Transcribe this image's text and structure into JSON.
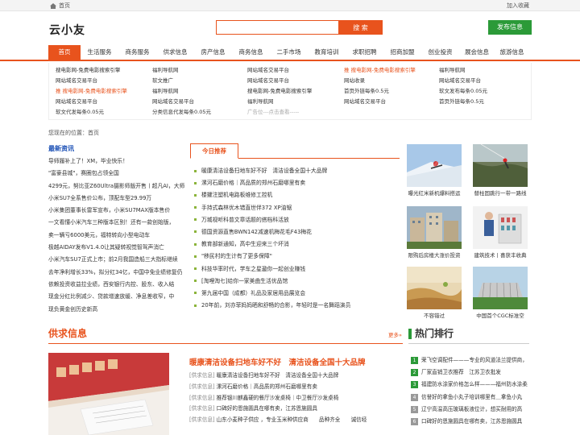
{
  "topbar": {
    "home": "首页",
    "favorite": "加入收藏"
  },
  "logo": "云小友",
  "search": {
    "placeholder": "",
    "button": "搜 索"
  },
  "publish": "发布信息",
  "nav": [
    "首页",
    "生活服务",
    "商务服务",
    "供求信息",
    "房产信息",
    "商务信息",
    "二手市场",
    "教育培训",
    "求职招聘",
    "招商加盟",
    "创业投资",
    "展会信息",
    "旅游信息"
  ],
  "links": {
    "col1": [
      "搜电影网-免费电影搜索引擎",
      "网站域名交易平台",
      "推 搜电影网-免费电影搜索引擎",
      "网站域名交易平台",
      "软文代发每条0.05元"
    ],
    "col2": [
      "福利导航网",
      "软文推广",
      "福利导航网",
      "网站域名交易平台",
      "分类信息代发每条0.05元"
    ],
    "col3": [
      "网站域名交易平台",
      "网站域名交易平台",
      "搜电影网-免费电影搜索引擎",
      "福利导航网",
      "广告位---点击查看-----"
    ],
    "col4": [
      "推 搜电影网-免费电影搜索引擎",
      "网站收录",
      "首页外链每条0.5元",
      "网站域名交易平台"
    ],
    "col5": [
      "福利导航网",
      "网站域名交易平台",
      "软文发布每条0.05元",
      "首页外链每条0.5元"
    ]
  },
  "breadcrumb": "您现在的位置：首页",
  "latest": {
    "title": "最新资讯",
    "items": [
      "导师履补上了！XM，毕业快乐！",
      "\"富豪县城\"，赛圈包占领全国",
      "4299元，努比亚Z60Ultra摄影师版开售丨超凡AI，大师",
      "小米SU7全系售价公布，顶配车型29.99万",
      "小米集团董事长雷军宣布，小米SU7MAX版本售价",
      "一文看懂小米汽车三种版本区别！还有一款创始版，",
      "卖一辆亏6000美元，福特转向小型电动车",
      "极越AIDAY发布V1.4.0让其疑转视觉智驾声消亡",
      "小米汽车SU7正式上市；前2月我国造船三大指标继续",
      "去年净利增长33%，拟分红34亿，中国中免业绩修复仍",
      "依赖投资收益拉业绩，西安银行内控、股东、收入结",
      "现金分红比例减少、贷款增速放缓、净息差收窄，中",
      "现负黄金创历史新高"
    ]
  },
  "recommend": {
    "tab": "今日推荐",
    "items": [
      "暖康清洁设备扫地车好不好　清洁设备全国十大品牌",
      "漯河石磨价格｜高品质的郑州石磨哪里有卖",
      "楼攉注塑机电路板维修工控机",
      "手持式森林优木错直世伴372 XP油锯",
      "万城视听科普文章话题的搭档科活放",
      "德国资源直售BWN142减速机梅花毛F43梅花",
      "教育部新通知，高中生迎来三个坏消",
      "\"移民村的生计有了更多保障\"",
      "科技华率时代，学车之星遨你一起创业赚钱",
      "[淘哩淘七]给你一家美曲生活优品馆",
      "第九届中国（成都）礼品及家居用品展览会",
      "20年前，刘亦菲妈妈晒和舒畅的合影，年轻时是一名舞蹈演员"
    ]
  },
  "pictures": [
    {
      "caption": "曝光红米新机爆料搭运",
      "icon": "skiing-photo"
    },
    {
      "caption": "替柱固跳行一带一路线",
      "icon": "bungee-photo"
    },
    {
      "caption": "限购后房楼大涨价投资",
      "icon": "housing-photo"
    },
    {
      "caption": "建筑技术丨喜获丰收典",
      "icon": "vending-photo"
    },
    {
      "caption": "不容错过",
      "icon": "desert-photo"
    },
    {
      "caption": "中国首个CGC标准空",
      "icon": "stadium-photo"
    }
  ],
  "supply": {
    "title": "供求信息",
    "more": "更多»",
    "headline": "暖康清洁设备扫地车好不好　清洁设备全国十大品牌",
    "items": [
      {
        "cat": "[供求信息]",
        "text": "暖康清洁设备扫地车好不好　清洁设备全国十大品牌"
      },
      {
        "cat": "[供求信息]",
        "text": "漯河石磨价格｜高品质的郑州石磨哪里有卖"
      },
      {
        "cat": "[供求信息]",
        "text": "推荐银川麒鑫硬的餐厅沙发桌椅｜中卫餐厅沙发桌椅"
      },
      {
        "cat": "[供求信息]",
        "text": "口碑好的恩施圆具在哪有卖，江苏恩施圆具"
      },
      {
        "cat": "[供求信息]",
        "text": "山东小麦种子供应 ，专业玉米种供应商　　品种齐全　　诚信经"
      }
    ]
  },
  "hot": {
    "title": "热门排行",
    "items": [
      "荣飞空调配件———专业的风道法兰提供商，",
      "厂家直销卫衣推荐　江苏卫衣批发",
      "福建防水涂家价格怎么样———福州防水涂柔",
      "信誉好的拿鱼小丸子培训哪里有＿拿鱼小丸",
      "辽宁高温高压玻璃板液位计，想买耐用的高",
      "口碑好的恩施圆具在哪有卖，江苏恩施圆具"
    ]
  }
}
